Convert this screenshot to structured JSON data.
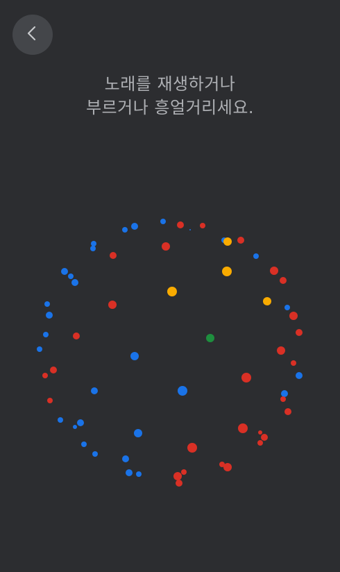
{
  "back_button": {
    "icon": "chevron-left-icon",
    "label": "Back"
  },
  "prompt": {
    "line1": "노래를 재생하거나",
    "line2": "부르거나 흥얼거리세요."
  },
  "colors": {
    "background": "#2c2d30",
    "button_bg": "#44464a",
    "text": "#aeb0b4",
    "blue": "#1a73e8",
    "red": "#d93025",
    "yellow": "#f9ab00",
    "green": "#1e8e3e"
  }
}
